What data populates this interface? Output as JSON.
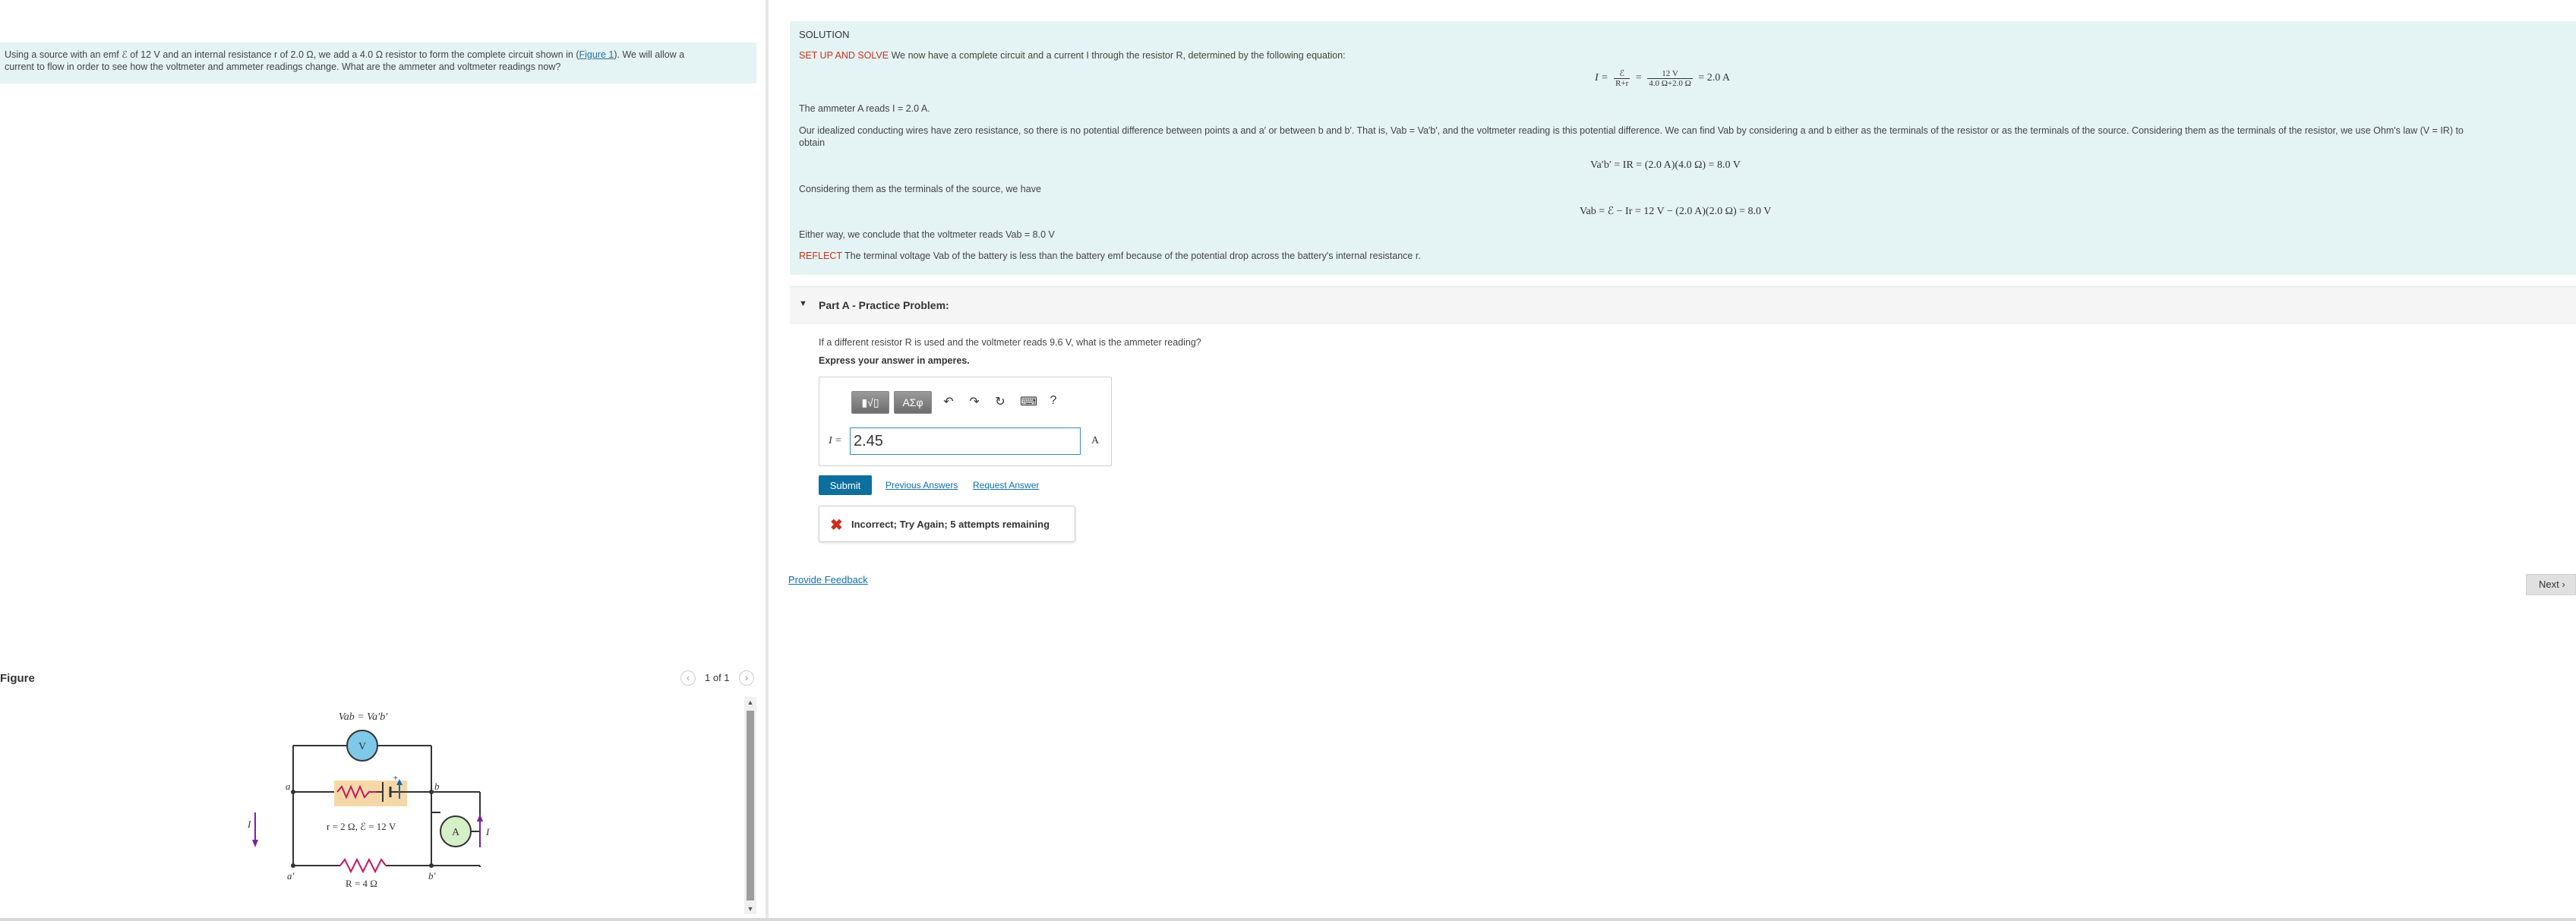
{
  "problem": {
    "text_before_link": "Using a source with an emf ℰ of 12 V and an internal resistance r of 2.0 Ω, we add a 4.0 Ω resistor to form the complete circuit shown in (",
    "link": "Figure 1",
    "text_after_link": "). We will allow a",
    "text_line2": "current to flow in order to see how the voltmeter and ammeter readings change. What are the ammeter and voltmeter readings now?"
  },
  "figure": {
    "label": "Figure",
    "pager": "1 of 1",
    "label_vab": "Vab = Va′b′",
    "label_a": "a",
    "label_b": "b",
    "label_a2": "a′",
    "label_b2": "b′",
    "label_r": "r = 2 Ω, ℰ = 12 V",
    "label_R": "R = 4 Ω",
    "label_I_left": "I",
    "label_I_right": "I",
    "voltmeter": "V",
    "ammeter": "A",
    "colors": {
      "wire": "#333333",
      "resistor": "#c2185b",
      "voltmeter_fill": "#7ec8e8",
      "ammeter_fill": "#d5efc7",
      "battery_bg": "#f6d8a8",
      "current_arrow": "#7b1fa2"
    }
  },
  "solution": {
    "heading": "SOLUTION",
    "setup_label": "SET UP AND SOLVE",
    "setup_text": " We now have a complete circuit and a current I through the resistor R, determined by the following equation:",
    "eq1_lhs": "I =",
    "eq1_frac1_num": "ℰ",
    "eq1_frac1_den": "R+r",
    "eq1_eq": "=",
    "eq1_frac2_num": "12 V",
    "eq1_frac2_den": "4.0 Ω+2.0 Ω",
    "eq1_rhs": "= 2.0 A",
    "ammeter_reads": "The ammeter A reads I = 2.0 A.",
    "idealized_line1": "Our idealized conducting wires have zero resistance, so there is no potential difference between points a and a′ or between b and b′. That is, Vab = Va′b′, and the voltmeter reading is this potential difference. We can find Vab by considering a and b either as the terminals of the resistor or as the terminals of the source. Considering them as the terminals of the resistor, we use Ohm's law (V = IR) to",
    "idealized_line2": "obtain",
    "eq2": "Va′b′ = IR = (2.0 A)(4.0 Ω) = 8.0 V",
    "considering_source": "Considering them as the terminals of the source, we have",
    "eq3": "Vab = ℰ − Ir = 12 V − (2.0 A)(2.0 Ω) = 8.0 V",
    "either_way": "Either way, we conclude that the voltmeter reads Vab = 8.0 V",
    "reflect_label": "REFLECT",
    "reflect_text": " The terminal voltage Vab of the battery is less than the battery emf because of the potential drop across the battery's internal resistance r."
  },
  "partA": {
    "title": "Part A - Practice Problem:",
    "question": "If a different resistor R is used and the voltmeter reads 9.6 V, what is the ammeter reading?",
    "express": "Express your answer in amperes.",
    "toolbar": {
      "templates": "▮√▯",
      "symbols": "ΑΣφ",
      "undo": "↶",
      "redo": "↷",
      "reset": "↻",
      "keyboard": "⌨",
      "help": "?"
    },
    "answer_label": "I =",
    "answer_value": "2.45",
    "unit": "A",
    "submit": "Submit",
    "previous_answers": "Previous Answers",
    "request_answer": "Request Answer",
    "feedback": "Incorrect; Try Again; 5 attempts remaining"
  },
  "footer": {
    "provide_feedback": "Provide Feedback",
    "next": "Next"
  }
}
